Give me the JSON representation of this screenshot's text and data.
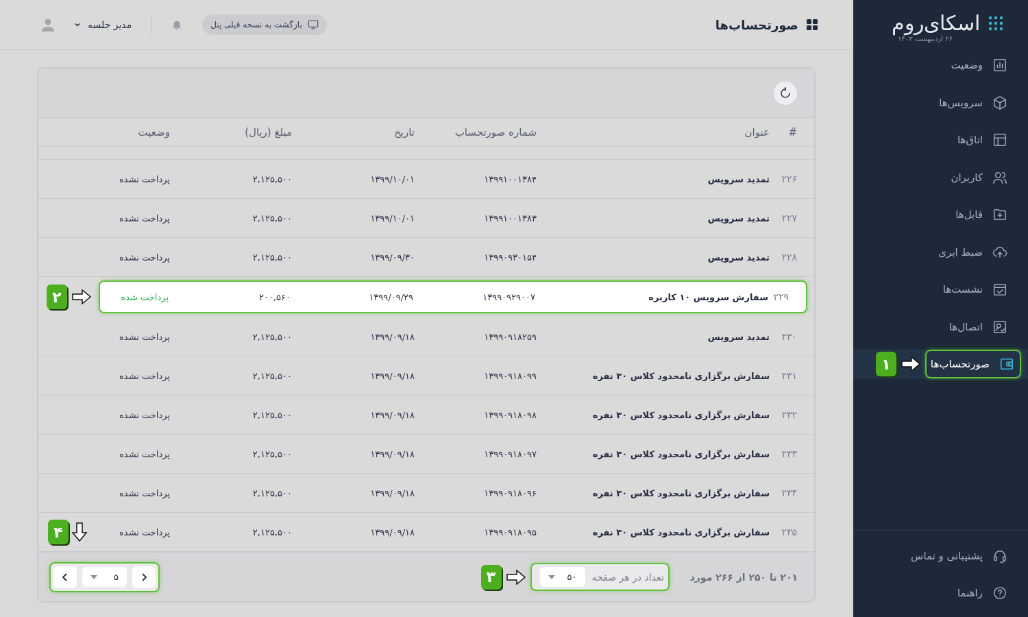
{
  "sidebar": {
    "logo": "اسکای‌روم",
    "date": "۲۶ اردیبهشت ۱۴۰۳",
    "items": [
      {
        "label": "وضعیت",
        "kind": "chart",
        "selected": false
      },
      {
        "label": "سرویس‌ها",
        "kind": "cube",
        "selected": false
      },
      {
        "label": "اتاق‌ها",
        "kind": "layout",
        "selected": false
      },
      {
        "label": "کاربران",
        "kind": "users",
        "selected": false
      },
      {
        "label": "فایل‌ها",
        "kind": "folder",
        "selected": false
      },
      {
        "label": "ضبط ابری",
        "kind": "cloud",
        "selected": false
      },
      {
        "label": "نشست‌ها",
        "kind": "calendar",
        "selected": false
      },
      {
        "label": "اتصال‌ها",
        "kind": "contact",
        "selected": false
      },
      {
        "label": "صورتحساب‌ها",
        "kind": "wallet",
        "selected": true,
        "callout": {
          "number": "۱",
          "kind": "right"
        }
      }
    ],
    "footer_items": [
      {
        "label": "پشتیبانی و تماس",
        "kind": "headset"
      },
      {
        "label": "راهنما",
        "kind": "help"
      }
    ]
  },
  "header": {
    "title": "صورتحساب‌ها",
    "back_button": "بازگشت به نسخه قبلی پنل",
    "user": "مدیر جلسه"
  },
  "table": {
    "columns": [
      "#",
      "عنوان",
      "شماره صورتحساب",
      "تاریخ",
      "مبلغ (ریال)",
      "وضعیت"
    ],
    "rows": [
      {
        "index": "۲۲۶",
        "title": "تمدید سرویس",
        "number": "۱۳۹۹۱۰۰۱۳۸۴",
        "date": "۱۳۹۹/۱۰/۰۱",
        "amount": "۲,۱۲۵,۵۰۰",
        "status": "پرداخت نشده",
        "paid": false,
        "highlighted": false
      },
      {
        "index": "۲۲۷",
        "title": "تمدید سرویس",
        "number": "۱۳۹۹۱۰۰۱۳۸۳",
        "date": "۱۳۹۹/۱۰/۰۱",
        "amount": "۲,۱۲۵,۵۰۰",
        "status": "پرداخت نشده",
        "paid": false,
        "highlighted": false
      },
      {
        "index": "۲۲۸",
        "title": "تمدید سرویس",
        "number": "۱۳۹۹۰۹۳۰۱۵۴",
        "date": "۱۳۹۹/۰۹/۳۰",
        "amount": "۲,۱۲۵,۵۰۰",
        "status": "پرداخت نشده",
        "paid": false,
        "highlighted": false
      },
      {
        "index": "۲۲۹",
        "title": "سفارش سرویس ۱۰ کاربره",
        "number": "۱۳۹۹۰۹۲۹۰۰۷",
        "date": "۱۳۹۹/۰۹/۲۹",
        "amount": "۲۰۰,۵۶۰",
        "status": "پرداخت شده",
        "paid": true,
        "highlighted": true,
        "callout": {
          "number": "۲",
          "kind": "right"
        }
      },
      {
        "index": "۲۳۰",
        "title": "تمدید سرویس",
        "number": "۱۳۹۹۰۹۱۸۲۵۹",
        "date": "۱۳۹۹/۰۹/۱۸",
        "amount": "۲,۱۲۵,۵۰۰",
        "status": "پرداخت نشده",
        "paid": false,
        "highlighted": false
      },
      {
        "index": "۲۳۱",
        "title": "سفارش برگزاری نامحدود کلاس ۳۰ نفره",
        "number": "۱۳۹۹۰۹۱۸۰۹۹",
        "date": "۱۳۹۹/۰۹/۱۸",
        "amount": "۲,۱۲۵,۵۰۰",
        "status": "پرداخت نشده",
        "paid": false,
        "highlighted": false
      },
      {
        "index": "۲۳۲",
        "title": "سفارش برگزاری نامحدود کلاس ۳۰ نفره",
        "number": "۱۳۹۹۰۹۱۸۰۹۸",
        "date": "۱۳۹۹/۰۹/۱۸",
        "amount": "۲,۱۲۵,۵۰۰",
        "status": "پرداخت نشده",
        "paid": false,
        "highlighted": false
      },
      {
        "index": "۲۳۳",
        "title": "سفارش برگزاری نامحدود کلاس ۳۰ نفره",
        "number": "۱۳۹۹۰۹۱۸۰۹۷",
        "date": "۱۳۹۹/۰۹/۱۸",
        "amount": "۲,۱۲۵,۵۰۰",
        "status": "پرداخت نشده",
        "paid": false,
        "highlighted": false
      },
      {
        "index": "۲۳۴",
        "title": "سفارش برگزاری نامحدود کلاس ۳۰ نفره",
        "number": "۱۳۹۹۰۹۱۸۰۹۶",
        "date": "۱۳۹۹/۰۹/۱۸",
        "amount": "۲,۱۲۵,۵۰۰",
        "status": "پرداخت نشده",
        "paid": false,
        "highlighted": false
      },
      {
        "index": "۲۳۵",
        "title": "سفارش برگزاری نامحدود کلاس ۳۰ نفره",
        "number": "۱۳۹۹۰۹۱۸۰۹۵",
        "date": "۱۳۹۹/۰۹/۱۸",
        "amount": "۲,۱۲۵,۵۰۰",
        "status": "پرداخت نشده",
        "paid": false,
        "highlighted": false,
        "callout": {
          "number": "۴",
          "kind": "down"
        }
      }
    ]
  },
  "footer": {
    "range": "۲۰۱ تا ۲۵۰ از ۲۶۶ مورد",
    "per_page_label": "تعداد در هر صفحه",
    "per_page": "۵۰",
    "per_page_callout": {
      "number": "۳",
      "kind": "right"
    },
    "page": "۵"
  }
}
